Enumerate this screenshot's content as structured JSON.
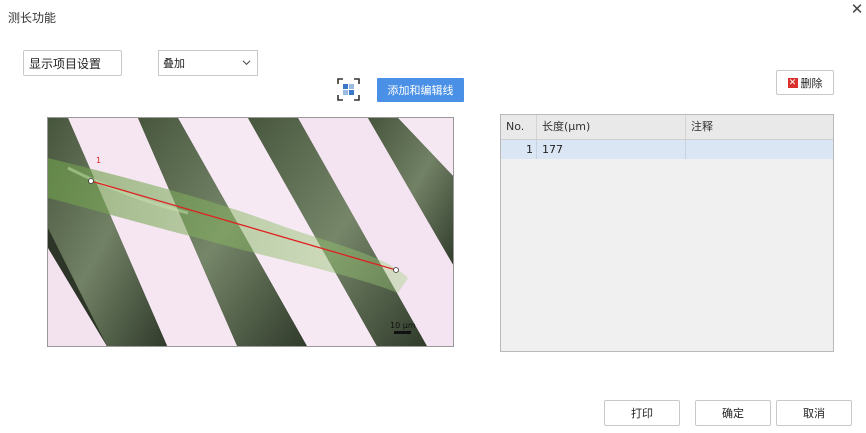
{
  "window": {
    "title": "测长功能",
    "close_glyph": "✕"
  },
  "toolbar": {
    "settings_label": "显示项目设置",
    "mode_selected": "叠加",
    "add_edit_label": "添加和编辑线",
    "delete_label": "删除"
  },
  "image": {
    "scale_bar_label": "10 μm",
    "line_label": "1"
  },
  "table": {
    "columns": [
      "No.",
      "长度(μm)",
      "注释"
    ],
    "rows": [
      {
        "no": "1",
        "length": "177",
        "note": ""
      }
    ]
  },
  "footer": {
    "print_label": "打印",
    "ok_label": "确定",
    "cancel_label": "取消"
  },
  "colors": {
    "accent": "#4a90e6",
    "measure_line": "#e02020",
    "delete_icon": "#d9302b",
    "selected_row": "#dbe6f4"
  },
  "icons": [
    "close-icon",
    "chevron-down-icon",
    "fit-view-icon",
    "delete-icon"
  ]
}
